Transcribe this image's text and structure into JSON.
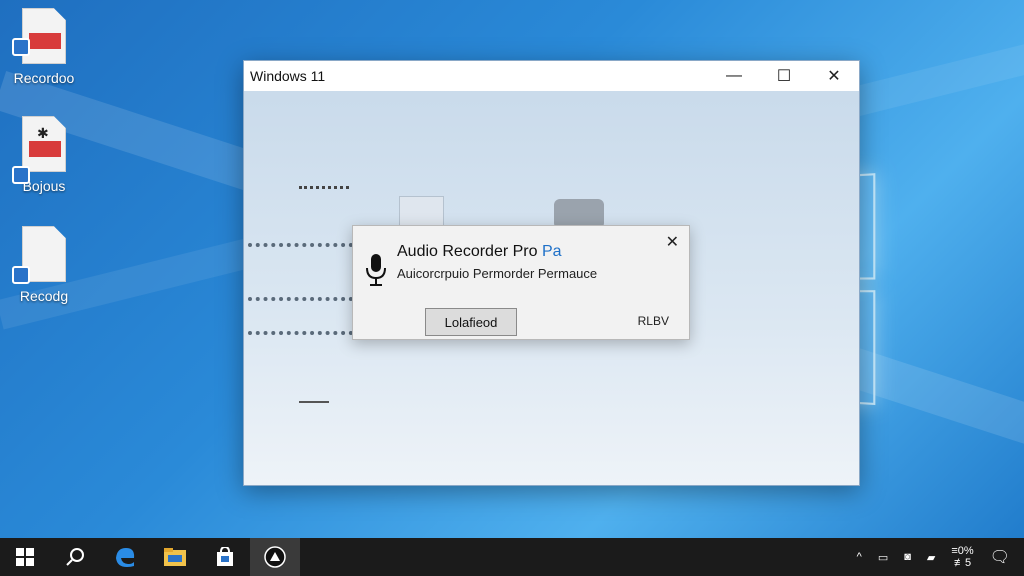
{
  "desktop": {
    "icons": [
      {
        "label": "Recordoo",
        "icon": "document-icon"
      },
      {
        "label": "Bojous",
        "icon": "document-bug-icon"
      },
      {
        "label": "Recodg",
        "icon": "document-icon"
      }
    ]
  },
  "window": {
    "title": "Windows 11",
    "controls": {
      "minimize": "—",
      "maximize": "☐",
      "close": "✕"
    }
  },
  "dialog": {
    "title_main": "Audio Recorder Pro",
    "title_accent": "Pa",
    "subtitle": "Auicorcrpuio Permorder Permauce",
    "button_label": "Lolafieod",
    "link_label": "RLBV",
    "close": "✕",
    "icon": "microphone-icon"
  },
  "taskbar": {
    "items": [
      {
        "name": "start-icon"
      },
      {
        "name": "search-icon"
      },
      {
        "name": "edge-icon"
      },
      {
        "name": "file-explorer-icon"
      },
      {
        "name": "store-icon"
      },
      {
        "name": "app-icon"
      }
    ],
    "tray": {
      "chevron": "^",
      "clock_line1": "≡0%",
      "clock_line2": "≢5"
    }
  }
}
